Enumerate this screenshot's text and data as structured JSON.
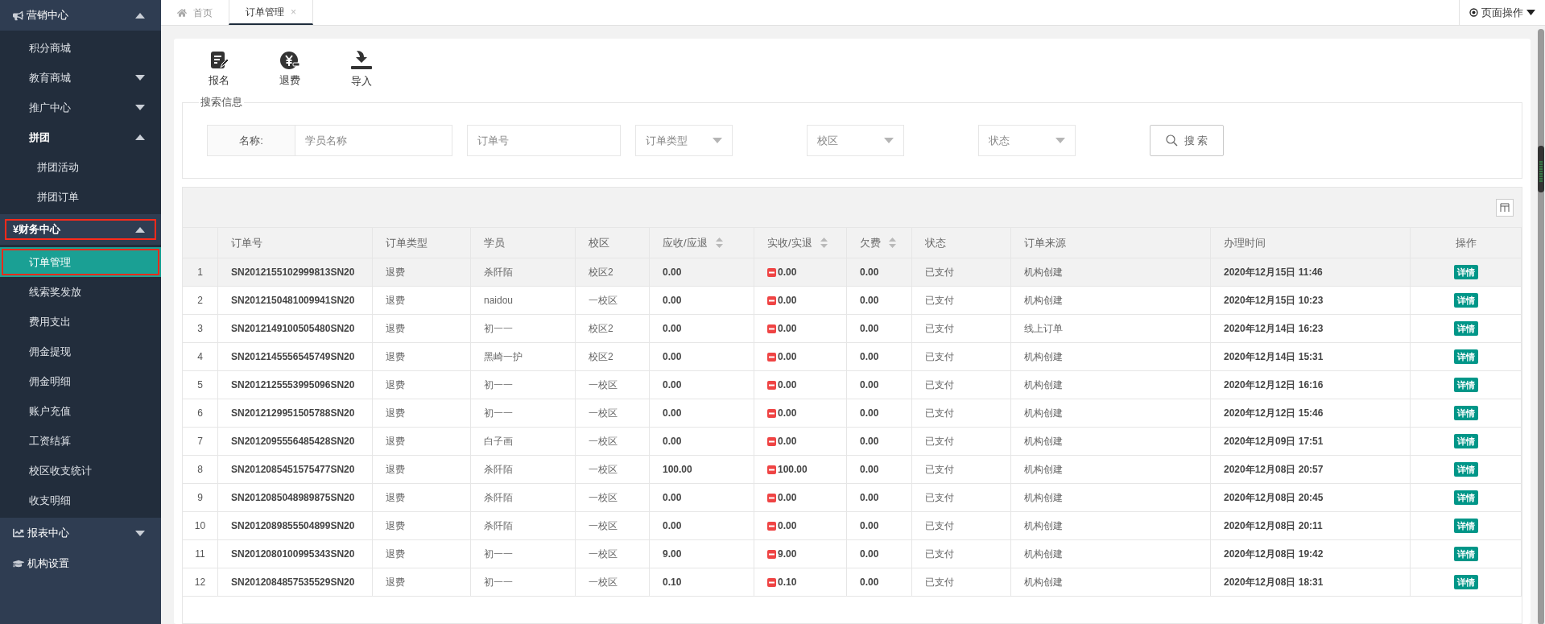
{
  "sidebar": {
    "groups": [
      {
        "label": "营销中心",
        "expanded": true,
        "marked": false,
        "children": [
          {
            "label": "积分商城",
            "selected": false,
            "marked": false
          },
          {
            "label": "教育商城",
            "selected": false,
            "marked": false,
            "expanded": false
          },
          {
            "label": "推广中心",
            "selected": false,
            "marked": false,
            "expanded": false
          },
          {
            "label": "拼团",
            "selected": false,
            "marked": false,
            "expanded": true,
            "children": [
              {
                "label": "拼团活动",
                "selected": false,
                "marked": false
              },
              {
                "label": "拼团订单",
                "selected": false,
                "marked": false
              }
            ]
          }
        ]
      },
      {
        "label": "¥财务中心",
        "expanded": true,
        "marked": true,
        "children": [
          {
            "label": "订单管理",
            "selected": true,
            "marked": true
          },
          {
            "label": "线索奖发放",
            "selected": false,
            "marked": false
          },
          {
            "label": "费用支出",
            "selected": false,
            "marked": false
          },
          {
            "label": "佣金提现",
            "selected": false,
            "marked": false
          },
          {
            "label": "佣金明细",
            "selected": false,
            "marked": false
          },
          {
            "label": "账户充值",
            "selected": false,
            "marked": false
          },
          {
            "label": "工资结算",
            "selected": false,
            "marked": false
          },
          {
            "label": "校区收支统计",
            "selected": false,
            "marked": false
          },
          {
            "label": "收支明细",
            "selected": false,
            "marked": false
          }
        ]
      },
      {
        "label": "报表中心",
        "expanded": false,
        "marked": false
      },
      {
        "label": "机构设置",
        "marked": false
      }
    ]
  },
  "tabs": [
    {
      "label": "首页",
      "selected": false,
      "kind": "home"
    },
    {
      "label": "订单管理",
      "selected": true,
      "kind": "closable",
      "close": "×"
    }
  ],
  "page_actions": {
    "label": "页面操作"
  },
  "toolbar": [
    {
      "label": "报名",
      "kind": "signup"
    },
    {
      "label": "退费",
      "kind": "refund"
    },
    {
      "label": "导入",
      "kind": "import"
    }
  ],
  "search": {
    "legend": "搜索信息",
    "name_label": "名称:",
    "name_placeholder": "学员名称",
    "order_placeholder": "订单号",
    "selects": [
      {
        "placeholder": "订单类型"
      },
      {
        "placeholder": "校区"
      },
      {
        "placeholder": "状态"
      }
    ],
    "button": "搜 索"
  },
  "table": {
    "columns": [
      {
        "sortable": false
      },
      {
        "label": "订单号",
        "sortable": false
      },
      {
        "label": "订单类型",
        "sortable": false
      },
      {
        "label": "学员",
        "sortable": false
      },
      {
        "label": "校区",
        "sortable": false
      },
      {
        "label": "应收/应退",
        "sortable": true
      },
      {
        "label": "实收/实退",
        "sortable": true
      },
      {
        "label": "欠费",
        "sortable": true
      },
      {
        "label": "状态",
        "sortable": false
      },
      {
        "label": "订单来源",
        "sortable": false
      },
      {
        "label": "办理时间",
        "sortable": false
      },
      {
        "label": "操作",
        "sortable": false
      }
    ],
    "rows": [
      {
        "selected": true,
        "cells": [
          "1",
          "SN2012155102999813SN20",
          "退费",
          "杀阡陌",
          "校区2",
          "0.00",
          "0.00",
          "0.00",
          "已支付",
          "机构创建",
          "2020年12月15日 11:46",
          "详情"
        ]
      },
      {
        "selected": false,
        "cells": [
          "2",
          "SN2012150481009941SN20",
          "退费",
          "naidou",
          "一校区",
          "0.00",
          "0.00",
          "0.00",
          "已支付",
          "机构创建",
          "2020年12月15日 10:23",
          "详情"
        ]
      },
      {
        "selected": false,
        "cells": [
          "3",
          "SN2012149100505480SN20",
          "退费",
          "初一一",
          "校区2",
          "0.00",
          "0.00",
          "0.00",
          "已支付",
          "线上订单",
          "2020年12月14日 16:23",
          "详情"
        ]
      },
      {
        "selected": false,
        "cells": [
          "4",
          "SN2012145556545749SN20",
          "退费",
          "黑崎一护",
          "校区2",
          "0.00",
          "0.00",
          "0.00",
          "已支付",
          "机构创建",
          "2020年12月14日 15:31",
          "详情"
        ]
      },
      {
        "selected": false,
        "cells": [
          "5",
          "SN2012125553995096SN20",
          "退费",
          "初一一",
          "一校区",
          "0.00",
          "0.00",
          "0.00",
          "已支付",
          "机构创建",
          "2020年12月12日 16:16",
          "详情"
        ]
      },
      {
        "selected": false,
        "cells": [
          "6",
          "SN2012129951505788SN20",
          "退费",
          "初一一",
          "一校区",
          "0.00",
          "0.00",
          "0.00",
          "已支付",
          "机构创建",
          "2020年12月12日 15:46",
          "详情"
        ]
      },
      {
        "selected": false,
        "cells": [
          "7",
          "SN2012095556485428SN20",
          "退费",
          "白子画",
          "一校区",
          "0.00",
          "0.00",
          "0.00",
          "已支付",
          "机构创建",
          "2020年12月09日 17:51",
          "详情"
        ]
      },
      {
        "selected": false,
        "cells": [
          "8",
          "SN2012085451575477SN20",
          "退费",
          "杀阡陌",
          "一校区",
          "100.00",
          "100.00",
          "0.00",
          "已支付",
          "机构创建",
          "2020年12月08日 20:57",
          "详情"
        ]
      },
      {
        "selected": false,
        "cells": [
          "9",
          "SN2012085048989875SN20",
          "退费",
          "杀阡陌",
          "一校区",
          "0.00",
          "0.00",
          "0.00",
          "已支付",
          "机构创建",
          "2020年12月08日 20:45",
          "详情"
        ]
      },
      {
        "selected": false,
        "cells": [
          "10",
          "SN2012089855504899SN20",
          "退费",
          "杀阡陌",
          "一校区",
          "0.00",
          "0.00",
          "0.00",
          "已支付",
          "机构创建",
          "2020年12月08日 20:11",
          "详情"
        ]
      },
      {
        "selected": false,
        "cells": [
          "11",
          "SN2012080100995343SN20",
          "退费",
          "初一一",
          "一校区",
          "9.00",
          "9.00",
          "0.00",
          "已支付",
          "机构创建",
          "2020年12月08日 19:42",
          "详情"
        ]
      },
      {
        "selected": false,
        "cells": [
          "12",
          "SN2012084857535529SN20",
          "退费",
          "初一一",
          "一校区",
          "0.10",
          "0.10",
          "0.00",
          "已支付",
          "机构创建",
          "2020年12月08日 18:31",
          "详情"
        ]
      }
    ]
  }
}
